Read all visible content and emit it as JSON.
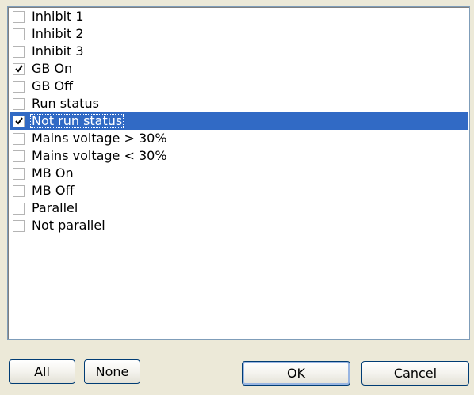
{
  "list": {
    "items": [
      {
        "label": "Inhibit 1",
        "checked": false,
        "selected": false
      },
      {
        "label": "Inhibit 2",
        "checked": false,
        "selected": false
      },
      {
        "label": "Inhibit 3",
        "checked": false,
        "selected": false
      },
      {
        "label": "GB On",
        "checked": true,
        "selected": false
      },
      {
        "label": "GB Off",
        "checked": false,
        "selected": false
      },
      {
        "label": "Run status",
        "checked": false,
        "selected": false
      },
      {
        "label": "Not run status",
        "checked": true,
        "selected": true
      },
      {
        "label": "Mains voltage > 30%",
        "checked": false,
        "selected": false
      },
      {
        "label": "Mains voltage < 30%",
        "checked": false,
        "selected": false
      },
      {
        "label": "MB On",
        "checked": false,
        "selected": false
      },
      {
        "label": "MB Off",
        "checked": false,
        "selected": false
      },
      {
        "label": "Parallel",
        "checked": false,
        "selected": false
      },
      {
        "label": "Not parallel",
        "checked": false,
        "selected": false
      }
    ]
  },
  "buttons": {
    "all_label": "All",
    "none_label": "None",
    "ok_label": "OK",
    "cancel_label": "Cancel"
  },
  "colors": {
    "selection": "#316ac5",
    "dialog_background": "#ece9d8",
    "list_border": "#7f9db9"
  }
}
